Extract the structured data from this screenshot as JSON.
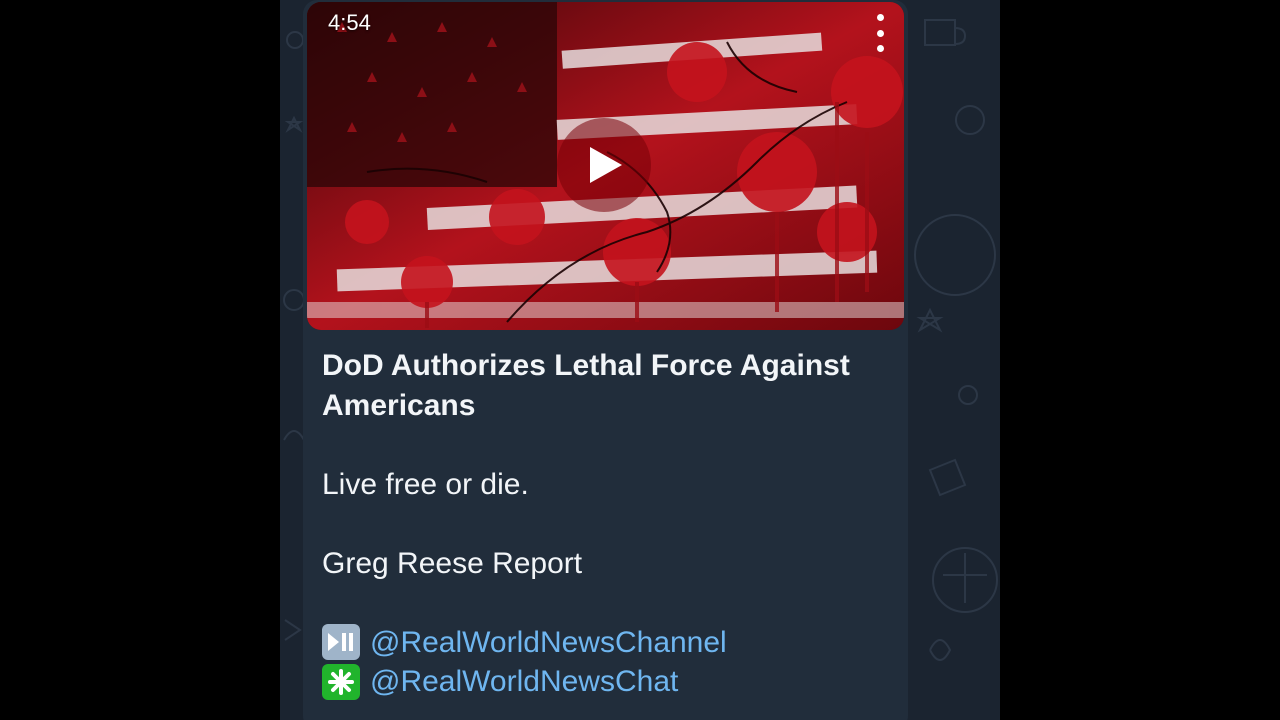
{
  "video": {
    "duration": "4:54",
    "menu_icon": "more-vertical-icon",
    "play_icon": "play-icon",
    "colors": {
      "primary": "#c1101a",
      "dark": "#200406",
      "light": "#e8e2e2"
    }
  },
  "message": {
    "title": "DoD Authorizes Lethal Force Against Americans",
    "line1": "Live free or die.",
    "line2": "Greg Reese Report",
    "links": [
      {
        "emoji": "play-pause-emoji",
        "label": "@RealWorldNewsChannel"
      },
      {
        "emoji": "eight-spoked-asterisk-emoji",
        "label": "@RealWorldNewsChat"
      }
    ]
  },
  "theme": {
    "background": "#1b2430",
    "bubble": "#212d3b",
    "link": "#6fb6f0",
    "text": "#f2f5f8"
  }
}
